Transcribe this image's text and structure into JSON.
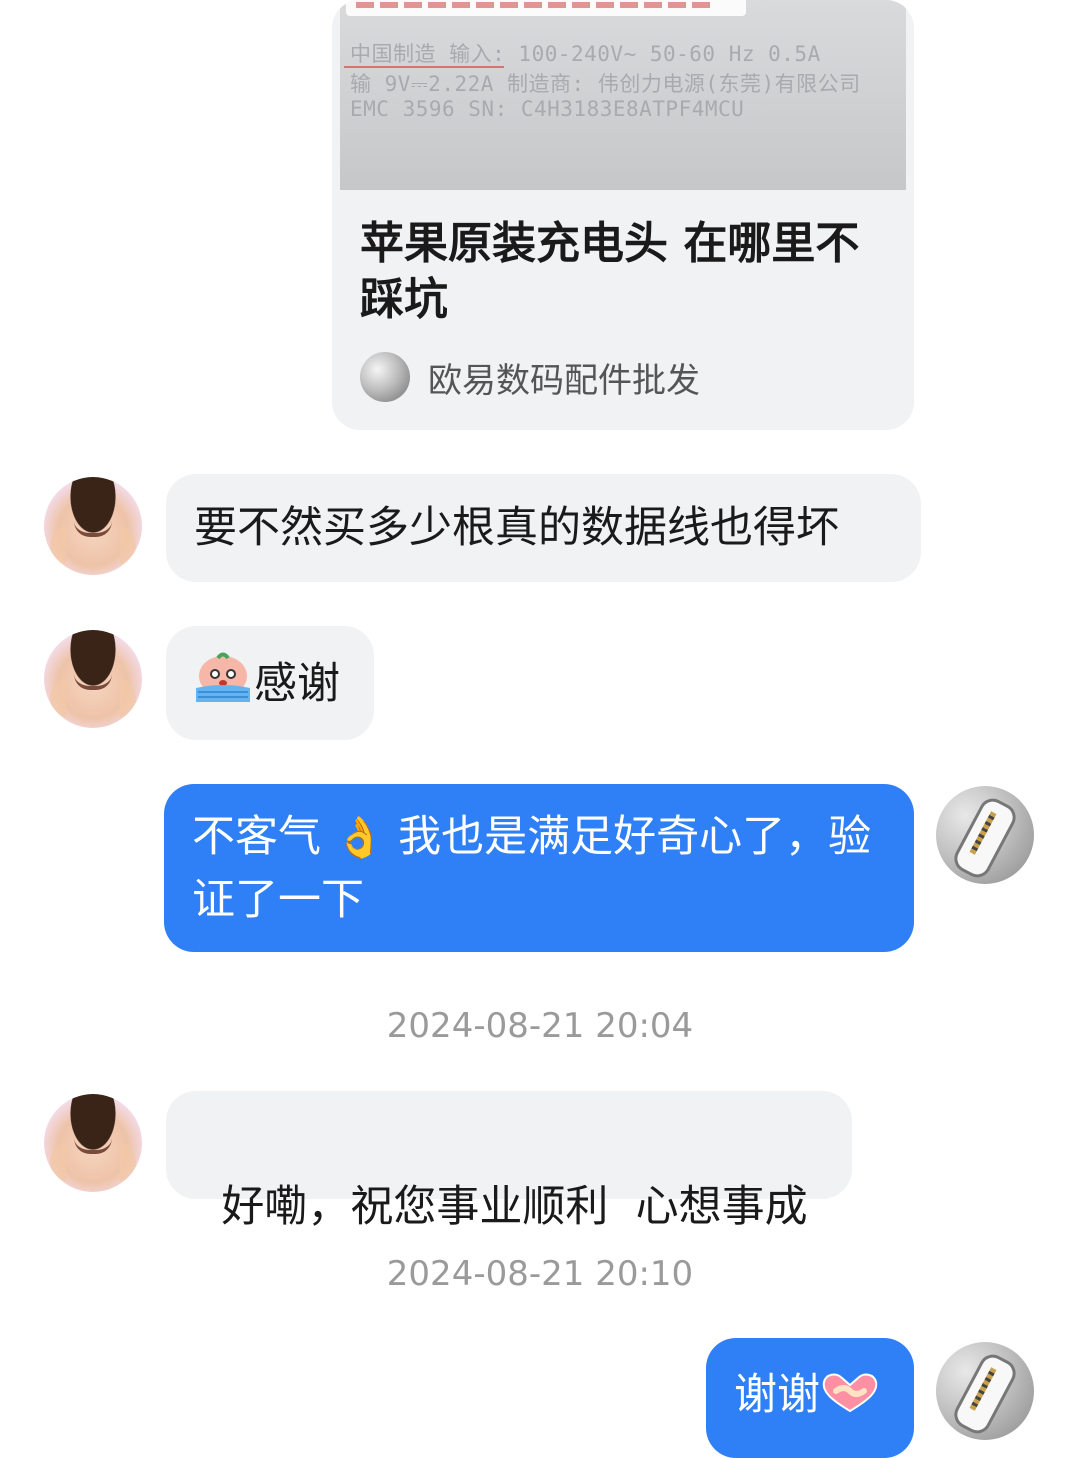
{
  "shared_card": {
    "image_lines": [
      "中国制造 输入: 100-240V~ 50-60 Hz 0.5A",
      "输 9V⎓2.22A 制造商: 伟创力电源(东莞)有限公司",
      "EMC 3596 SN: C4H3183E8ATPF4MCU"
    ],
    "title": "苹果原装充电头 在哪里不踩坑",
    "source_name": "欧易数码配件批发"
  },
  "messages": [
    {
      "side": "left",
      "text": "要不然买多少根真的数据线也得坏"
    },
    {
      "side": "left",
      "emoji": "crying-face-emoji",
      "text": "感谢"
    },
    {
      "side": "right",
      "text_a": "不客气 ",
      "emoji": "👌",
      "text_b": " 我也是满足好奇心了，验证了一下"
    },
    {
      "side": "left",
      "text": "好嘞，祝您事业顺利  心想事成"
    },
    {
      "side": "right",
      "text": "谢谢",
      "emoji": "handshake-emoji"
    }
  ],
  "timestamps": [
    "2024-08-21 20:04",
    "2024-08-21 20:10"
  ],
  "colors": {
    "sent_bubble": "#2f7ff6",
    "received_bubble": "#f1f2f4",
    "timestamp_text": "#9a9a9a"
  }
}
